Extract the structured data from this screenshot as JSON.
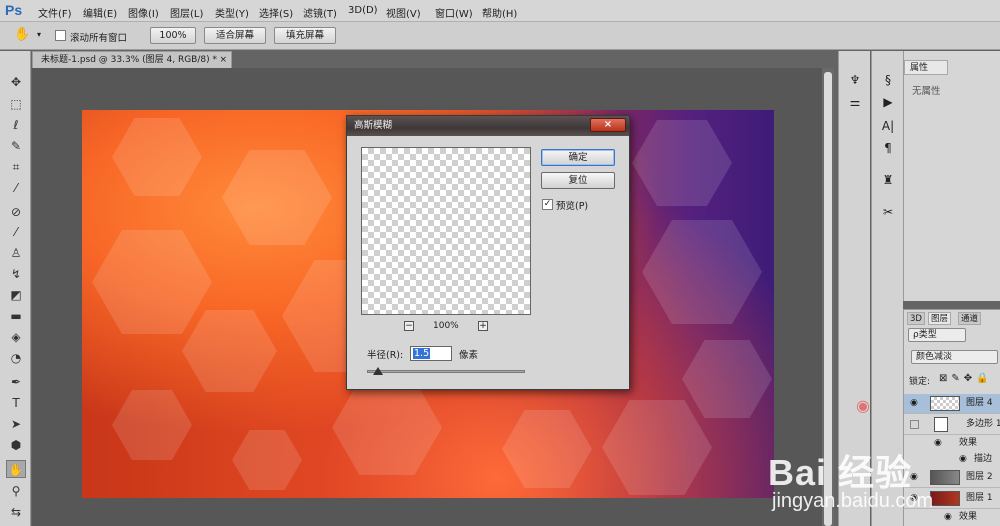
{
  "app": {
    "logo": "Ps"
  },
  "menu": [
    "文件(F)",
    "编辑(E)",
    "图像(I)",
    "图层(L)",
    "类型(Y)",
    "选择(S)",
    "滤镜(T)",
    "3D(D)",
    "视图(V)",
    "窗口(W)",
    "帮助(H)"
  ],
  "options": {
    "scroll_all": "滚动所有窗口",
    "zoom": "100%",
    "fit_screen": "适合屏幕",
    "fill_screen": "填充屏幕"
  },
  "document": {
    "tab_title": "未标题-1.psd @ 33.3% (图层 4, RGB/8) *",
    "close": "×"
  },
  "dialog": {
    "title": "高斯模糊",
    "close": "×",
    "ok": "确定",
    "reset": "复位",
    "preview_label": "预览(P)",
    "preview_checked": true,
    "zoom": "100%",
    "zoom_out": "−",
    "zoom_in": "+",
    "radius_label": "半径(R):",
    "radius_value": "1.5",
    "radius_unit": "像素"
  },
  "properties": {
    "tab": "属性",
    "content": "无属性"
  },
  "layers_panel": {
    "tabs": [
      "3D",
      "图层",
      "通道"
    ],
    "kind_filter": "ρ类型",
    "blend_mode": "颜色减淡",
    "lock_label": "锁定:",
    "layers": [
      {
        "name": "图层 4",
        "selected": true,
        "visible": true
      },
      {
        "name": "多边形 1",
        "selected": false,
        "visible": false
      },
      {
        "name": "效果",
        "sub": true
      },
      {
        "name": "描边",
        "sub": true
      },
      {
        "name": "图层 2",
        "selected": false,
        "visible": true
      },
      {
        "name": "图层 1",
        "selected": false,
        "visible": true
      },
      {
        "name": "效果",
        "sub": true
      }
    ]
  },
  "watermark": {
    "logo": "Bai 经验",
    "url": "jingyan.baidu.com"
  },
  "colors": {
    "accent": "#3375d6",
    "close_red": "#c0392b",
    "panel": "#d6d6d6"
  }
}
